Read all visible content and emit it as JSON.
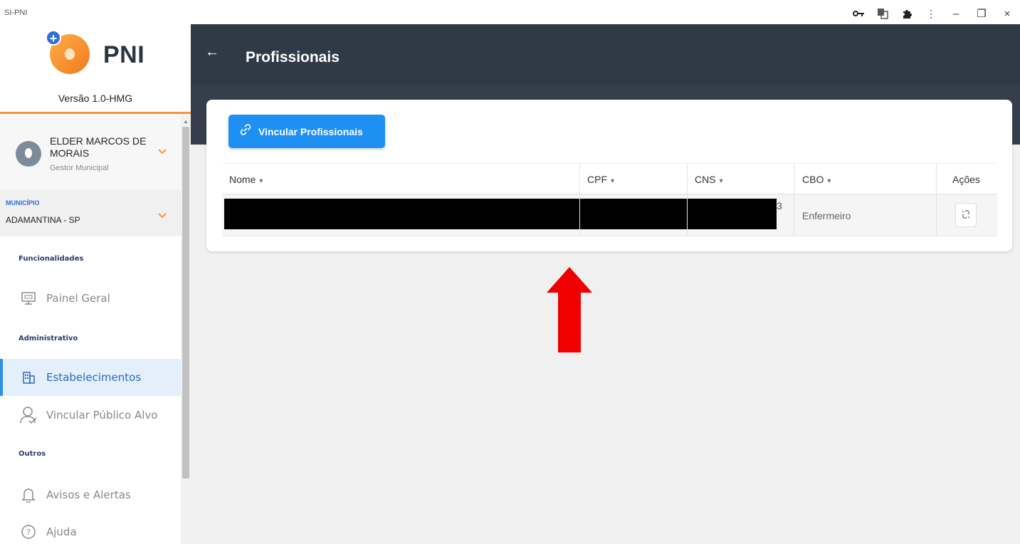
{
  "window": {
    "title": "SI-PNI",
    "toolbar_icons": [
      "key-icon",
      "translate-icon",
      "extensions-icon",
      "more-vert-icon"
    ],
    "controls": {
      "minimize": "–",
      "restore": "❐",
      "close": "×"
    }
  },
  "sidebar": {
    "logo_text": "PNI",
    "version": "Versão 1.0-HMG",
    "user": {
      "name": "ELDER MARCOS DE MORAIS",
      "role": "Gestor Municipal"
    },
    "municipio": {
      "label": "MUNICÍPIO",
      "value": "ADAMANTINA - SP"
    },
    "sections": {
      "funcionalidades": "Funcionalidades",
      "administrativo": "Administrativo",
      "outros": "Outros"
    },
    "items": {
      "painel_geral": "Painel Geral",
      "estabelecimentos": "Estabelecimentos",
      "vincular_publico_alvo": "Vincular Público Alvo",
      "avisos_alertas": "Avisos e Alertas",
      "ajuda": "Ajuda"
    },
    "accent_color": "#f5963c",
    "active_color": "#2b8fe8"
  },
  "header": {
    "back_icon": "←",
    "title": "Profissionais",
    "bg_color": "#2f3a47"
  },
  "main": {
    "link_button": {
      "icon": "𝓅",
      "label": "Vincular Profissionais",
      "color": "#1e90f4"
    },
    "table": {
      "columns": {
        "nome": "Nome",
        "cpf": "CPF",
        "cns": "CNS",
        "cbo": "CBO",
        "acoes": "Ações"
      },
      "sort_glyph": "▾",
      "rows": [
        {
          "nome": "",
          "cpf": "",
          "cns": "",
          "cns_visible_fragment": "3",
          "cbo": "Enfermeiro",
          "action_icon": "unlink-icon"
        }
      ]
    }
  }
}
